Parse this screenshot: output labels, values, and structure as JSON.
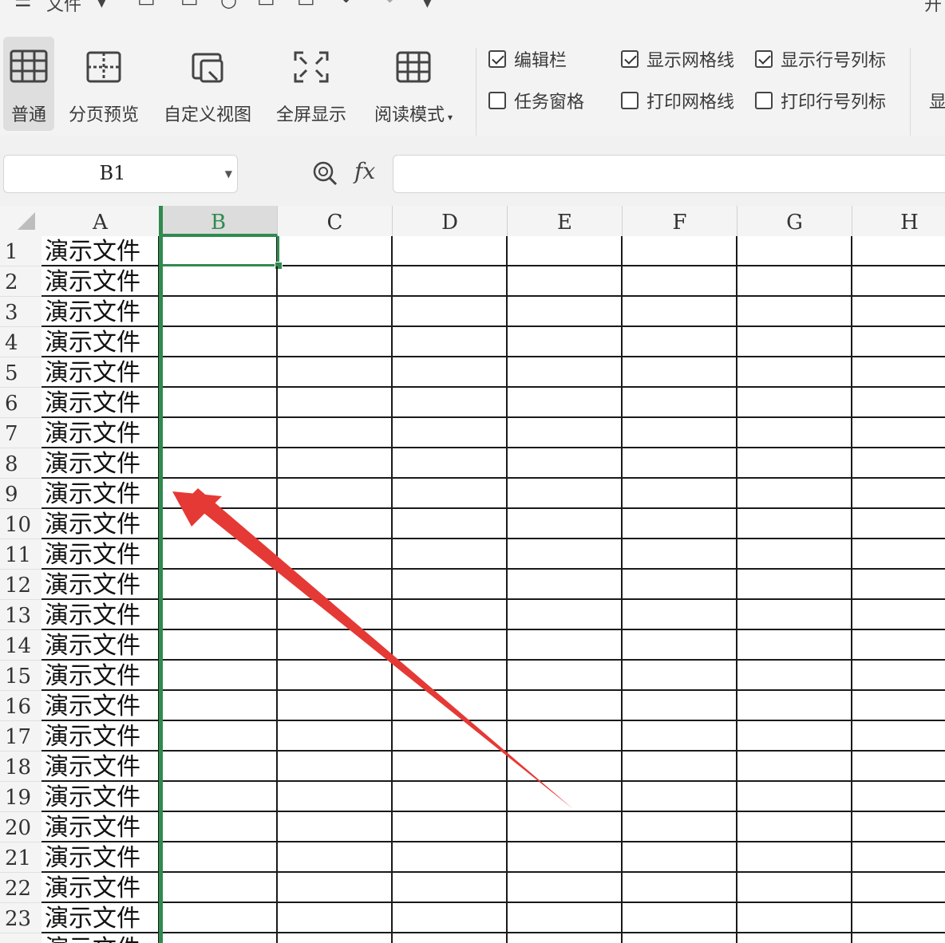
{
  "quick_access": {
    "menu_icon": "hamburger-icon",
    "file_label": "文件",
    "tail_label": "开"
  },
  "ribbon": {
    "buttons": [
      {
        "label": "普通",
        "icon": "normal-view-icon",
        "active": true
      },
      {
        "label": "分页预览",
        "icon": "page-break-preview-icon"
      },
      {
        "label": "自定义视图",
        "icon": "custom-view-icon"
      },
      {
        "label": "全屏显示",
        "icon": "fullscreen-icon"
      },
      {
        "label": "阅读模式",
        "icon": "reading-mode-icon"
      }
    ],
    "reading_mode_dropdown": "▾",
    "checkboxes": [
      {
        "label": "编辑栏",
        "checked": true
      },
      {
        "label": "显示网格线",
        "checked": true
      },
      {
        "label": "显示行号列标",
        "checked": true
      },
      {
        "label": "任务窗格",
        "checked": false
      },
      {
        "label": "打印网格线",
        "checked": false
      },
      {
        "label": "打印行号列标",
        "checked": false
      }
    ],
    "cut_label": "显"
  },
  "formula_bar": {
    "name_box": "B1",
    "fx_label": "fx",
    "formula_value": ""
  },
  "grid": {
    "columns": [
      "A",
      "B",
      "C",
      "D",
      "E",
      "F",
      "G",
      "H"
    ],
    "selected_column": "B",
    "selected_cell": "B1",
    "rows": [
      "1",
      "2",
      "3",
      "4",
      "5",
      "6",
      "7",
      "8",
      "9",
      "10",
      "11",
      "12",
      "13",
      "14",
      "15",
      "16",
      "17",
      "18",
      "19",
      "20",
      "21",
      "22",
      "23"
    ],
    "column_a_value": "演示文件"
  },
  "colors": {
    "accent_green": "#2f8b4f",
    "annotation_arrow": "#e53935"
  }
}
